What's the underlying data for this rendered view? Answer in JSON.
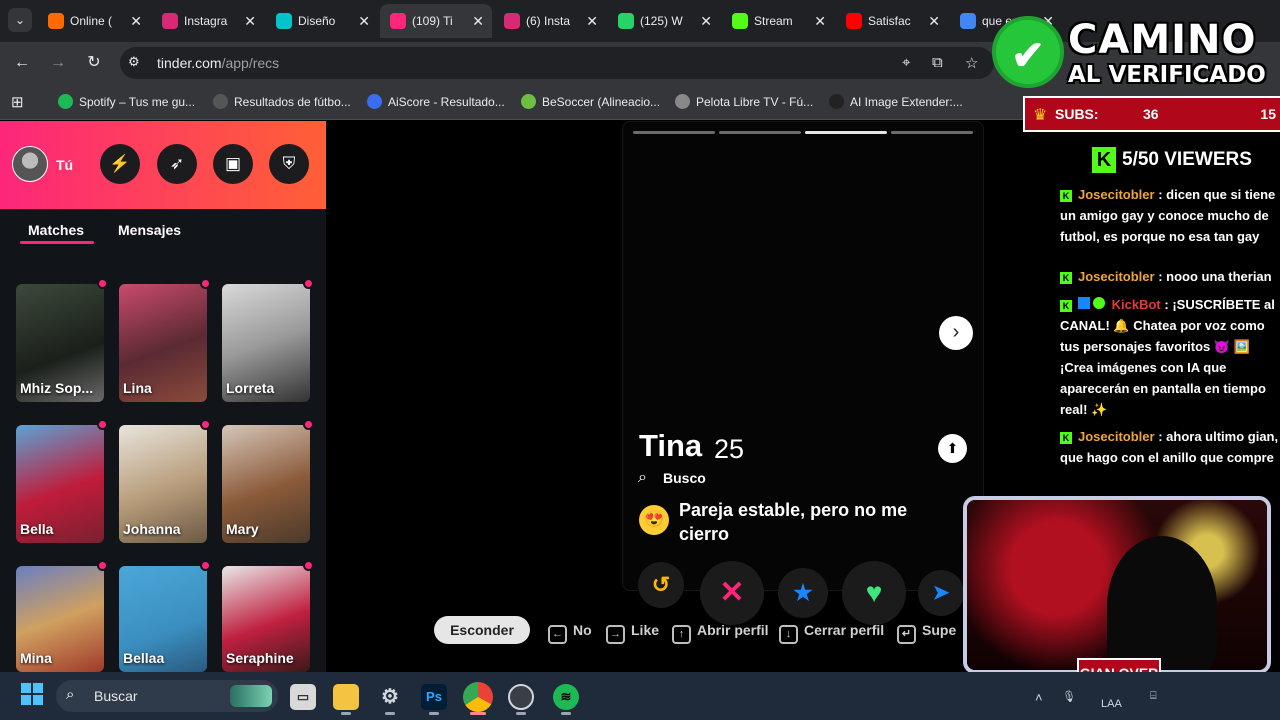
{
  "browser": {
    "tabs": [
      {
        "title": "Online (",
        "fav_color": "#ff6a00",
        "active": false
      },
      {
        "title": "Instagra",
        "fav_color": "#d62976",
        "active": false
      },
      {
        "title": "Diseño",
        "fav_color": "#00c4cc",
        "active": false
      },
      {
        "title": "(109) Ti",
        "fav_color": "#fd267a",
        "active": true
      },
      {
        "title": "(6) Insta",
        "fav_color": "#d62976",
        "active": false
      },
      {
        "title": "(125) W",
        "fav_color": "#25d366",
        "active": false
      },
      {
        "title": "Stream",
        "fav_color": "#53fc18",
        "active": false
      },
      {
        "title": "Satisfac",
        "fav_color": "#ff0000",
        "active": false
      },
      {
        "title": "que es",
        "fav_color": "#4285f4",
        "active": false
      }
    ],
    "url_host": "tinder.com",
    "url_path": "/app/recs",
    "bookmarks": [
      {
        "label": "Spotify – Tus me gu...",
        "color": "#1db954"
      },
      {
        "label": "Resultados de fútbo...",
        "color": "#555555"
      },
      {
        "label": "AiScore - Resultado...",
        "color": "#3a6df0"
      },
      {
        "label": "BeSoccer (Alineacio...",
        "color": "#6fbe44"
      },
      {
        "label": "Pelota Libre TV - Fú...",
        "color": "#888888"
      },
      {
        "label": "AI Image Extender:...",
        "color": "#222222"
      }
    ]
  },
  "sidebar": {
    "me_label": "Tú",
    "tabs": [
      "Matches",
      "Mensajes"
    ],
    "matches": [
      {
        "name": "Mhiz Sop...",
        "bg": "linear-gradient(160deg,#3c4a3a,#1a1f1a 60%,#6a6a6a)"
      },
      {
        "name": "Lina",
        "bg": "linear-gradient(160deg,#c94a6d,#5a2a33 55%,#8b4b3b)"
      },
      {
        "name": "Lorreta",
        "bg": "linear-gradient(160deg,#d9d9d9,#9a9a9a 50%,#333)"
      },
      {
        "name": "Bella",
        "bg": "linear-gradient(160deg,#5aa3d6,#c01c3a 55%,#7a2030)"
      },
      {
        "name": "Johanna",
        "bg": "linear-gradient(160deg,#e8e4dc,#b79c7a 55%,#6b5a44)"
      },
      {
        "name": "Mary",
        "bg": "linear-gradient(160deg,#d6c6b8,#8a5a3a 55%,#4a3a2a)"
      },
      {
        "name": "Mina",
        "bg": "linear-gradient(160deg,#6a7fc0,#d0a060 50%,#a03a2a)"
      },
      {
        "name": "Bellaa",
        "bg": "linear-gradient(160deg,#4ba7d8,#3a8fc0 60%,#2a5a80)"
      },
      {
        "name": "Seraphine",
        "bg": "linear-gradient(160deg,#e8e8e8,#c02040 55%,#3a1a1a)"
      }
    ]
  },
  "profile": {
    "name": "Tina",
    "age": "25",
    "looking_label": "Busco",
    "looking_value": "Pareja estable, pero no me cierro",
    "photo_count": 4,
    "active_photo": 3
  },
  "shortcuts": {
    "hide_label": "Esconder",
    "items": [
      {
        "key": "←",
        "label": "No"
      },
      {
        "key": "→",
        "label": "Like"
      },
      {
        "key": "↑",
        "label": "Abrir perfil"
      },
      {
        "key": "↓",
        "label": "Cerrar perfil"
      },
      {
        "key": "↵",
        "label": "Supe"
      }
    ]
  },
  "overlay": {
    "title_line1": "CAMINO",
    "title_line2": "AL VERIFICADO",
    "subs_label": "SUBS:",
    "subs_current": "36",
    "subs_goal": "15",
    "viewers_text": "5/50 VIEWERS",
    "chat": [
      {
        "user": "Josecitobler",
        "text": "dicen que si tiene un amigo gay y conoce mucho de futbol, es porque no esa tan gay"
      },
      {
        "user": "Josecitobler",
        "text": "nooo una therian"
      },
      {
        "user": "KickBot",
        "text": "¡SUSCRÍBETE al CANAL! 🔔 Chatea por voz como tus personajes favoritos 😈 🖼️ ¡Crea imágenes con IA que aparecerán en pantalla en tiempo real! ✨"
      },
      {
        "user": "Josecitobler",
        "text": "ahora ultimo gian, que hago con el anillo que compre"
      }
    ],
    "streamer_name": "GIAN OVER"
  },
  "taskbar": {
    "search_placeholder": "Buscar",
    "tray_lang": "LAA",
    "ps_label": "Ps"
  },
  "icons": {
    "back": "back-arrow-icon",
    "forward": "forward-arrow-icon",
    "reload": "reload-icon",
    "location": "location-icon",
    "install": "install-icon",
    "star": "bookmark-star-icon"
  },
  "colors": {
    "tinder_pink": "#fd267a",
    "tinder_orange": "#ff6036",
    "rewind": "#ffb800",
    "nope": "#fd267a",
    "super_like": "#1786ff",
    "like": "#3ce67d",
    "boost": "#1786ff",
    "kick_green": "#53fc18"
  }
}
